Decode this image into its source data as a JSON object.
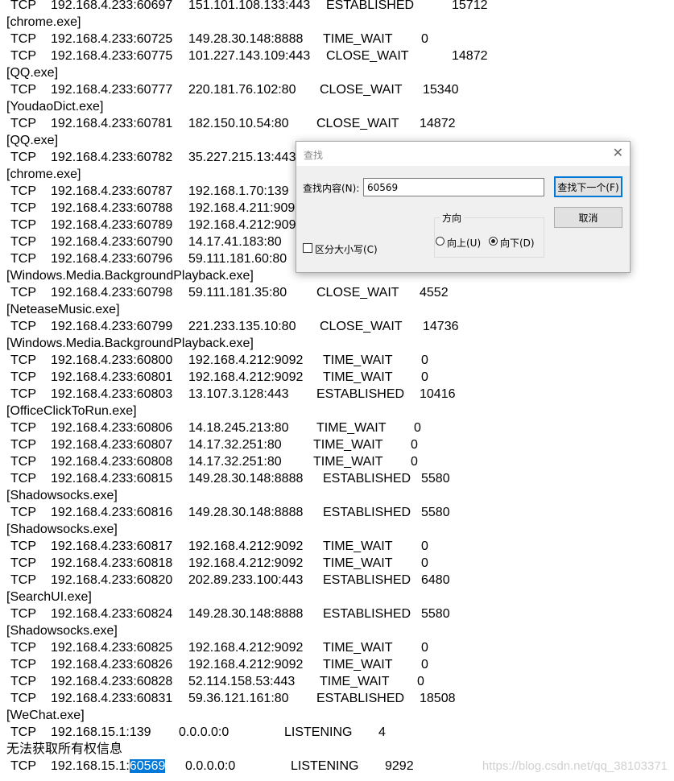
{
  "lines": [
    {
      "type": "conn",
      "proto": "TCP",
      "local": "192.168.4.233:60697",
      "foreign": "151.101.108.133:443",
      "state": "ESTABLISHED",
      "pid": "15712",
      "pos": "a"
    },
    {
      "type": "exe",
      "text": "[chrome.exe]"
    },
    {
      "type": "conn",
      "proto": "TCP",
      "local": "192.168.4.233:60725",
      "foreign": "149.28.30.148:8888",
      "state": "TIME_WAIT",
      "pid": "0",
      "pos": "b"
    },
    {
      "type": "conn",
      "proto": "TCP",
      "local": "192.168.4.233:60775",
      "foreign": "101.227.143.109:443",
      "state": "CLOSE_WAIT",
      "pid": "14872",
      "pos": "a"
    },
    {
      "type": "exe",
      "text": "[QQ.exe]"
    },
    {
      "type": "conn",
      "proto": "TCP",
      "local": "192.168.4.233:60777",
      "foreign": "220.181.76.102:80",
      "state": "CLOSE_WAIT",
      "pid": "15340",
      "pos": "c"
    },
    {
      "type": "exe",
      "text": "[YoudaoDict.exe]"
    },
    {
      "type": "conn",
      "proto": "TCP",
      "local": "192.168.4.233:60781",
      "foreign": "182.150.10.54:80",
      "state": "CLOSE_WAIT",
      "pid": "14872",
      "pos": "d"
    },
    {
      "type": "exe",
      "text": "[QQ.exe]"
    },
    {
      "type": "conn",
      "proto": "TCP",
      "local": "192.168.4.233:60782",
      "foreign": "35.227.215.13:443",
      "state": "",
      "pid": "",
      "pos": "a"
    },
    {
      "type": "exe",
      "text": "[chrome.exe]"
    },
    {
      "type": "conn",
      "proto": "TCP",
      "local": "192.168.4.233:60787",
      "foreign": "192.168.1.70:139",
      "state": "",
      "pid": "",
      "pos": "a"
    },
    {
      "type": "conn",
      "proto": "TCP",
      "local": "192.168.4.233:60788",
      "foreign": "192.168.4.211:909",
      "state": "",
      "pid": "",
      "pos": "a"
    },
    {
      "type": "conn",
      "proto": "TCP",
      "local": "192.168.4.233:60789",
      "foreign": "192.168.4.212:909",
      "state": "",
      "pid": "",
      "pos": "a"
    },
    {
      "type": "conn",
      "proto": "TCP",
      "local": "192.168.4.233:60790",
      "foreign": "14.17.41.183:80",
      "state": "",
      "pid": "",
      "pos": "a"
    },
    {
      "type": "conn",
      "proto": "TCP",
      "local": "192.168.4.233:60796",
      "foreign": "59.111.181.60:80",
      "state": "",
      "pid": "",
      "pos": "a"
    },
    {
      "type": "exe",
      "text": "[Windows.Media.BackgroundPlayback.exe]"
    },
    {
      "type": "conn",
      "proto": "TCP",
      "local": "192.168.4.233:60798",
      "foreign": "59.111.181.35:80",
      "state": "CLOSE_WAIT",
      "pid": "4552",
      "pos": "d"
    },
    {
      "type": "exe",
      "text": "[NeteaseMusic.exe]"
    },
    {
      "type": "conn",
      "proto": "TCP",
      "local": "192.168.4.233:60799",
      "foreign": "221.233.135.10:80",
      "state": "CLOSE_WAIT",
      "pid": "14736",
      "pos": "c"
    },
    {
      "type": "exe",
      "text": "[Windows.Media.BackgroundPlayback.exe]"
    },
    {
      "type": "conn",
      "proto": "TCP",
      "local": "192.168.4.233:60800",
      "foreign": "192.168.4.212:9092",
      "state": "TIME_WAIT",
      "pid": "0",
      "pos": "b"
    },
    {
      "type": "conn",
      "proto": "TCP",
      "local": "192.168.4.233:60801",
      "foreign": "192.168.4.212:9092",
      "state": "TIME_WAIT",
      "pid": "0",
      "pos": "b"
    },
    {
      "type": "conn",
      "proto": "TCP",
      "local": "192.168.4.233:60803",
      "foreign": "13.107.3.128:443",
      "state": "ESTABLISHED",
      "pid": "10416",
      "pos": "d"
    },
    {
      "type": "exe",
      "text": "[OfficeClickToRun.exe]"
    },
    {
      "type": "conn",
      "proto": "TCP",
      "local": "192.168.4.233:60806",
      "foreign": "14.18.245.213:80",
      "state": "TIME_WAIT",
      "pid": "0",
      "pos": "e"
    },
    {
      "type": "conn",
      "proto": "TCP",
      "local": "192.168.4.233:60807",
      "foreign": "14.17.32.251:80",
      "state": "TIME_WAIT",
      "pid": "0",
      "pos": "f"
    },
    {
      "type": "conn",
      "proto": "TCP",
      "local": "192.168.4.233:60808",
      "foreign": "14.17.32.251:80",
      "state": "TIME_WAIT",
      "pid": "0",
      "pos": "f"
    },
    {
      "type": "conn",
      "proto": "TCP",
      "local": "192.168.4.233:60815",
      "foreign": "149.28.30.148:8888",
      "state": "ESTABLISHED",
      "pid": "5580",
      "pos": "b"
    },
    {
      "type": "exe",
      "text": "[Shadowsocks.exe]"
    },
    {
      "type": "conn",
      "proto": "TCP",
      "local": "192.168.4.233:60816",
      "foreign": "149.28.30.148:8888",
      "state": "ESTABLISHED",
      "pid": "5580",
      "pos": "b"
    },
    {
      "type": "exe",
      "text": "[Shadowsocks.exe]"
    },
    {
      "type": "conn",
      "proto": "TCP",
      "local": "192.168.4.233:60817",
      "foreign": "192.168.4.212:9092",
      "state": "TIME_WAIT",
      "pid": "0",
      "pos": "b"
    },
    {
      "type": "conn",
      "proto": "TCP",
      "local": "192.168.4.233:60818",
      "foreign": "192.168.4.212:9092",
      "state": "TIME_WAIT",
      "pid": "0",
      "pos": "b"
    },
    {
      "type": "conn",
      "proto": "TCP",
      "local": "192.168.4.233:60820",
      "foreign": "202.89.233.100:443",
      "state": "ESTABLISHED",
      "pid": "6480",
      "pos": "b"
    },
    {
      "type": "exe",
      "text": "[SearchUI.exe]"
    },
    {
      "type": "conn",
      "proto": "TCP",
      "local": "192.168.4.233:60824",
      "foreign": "149.28.30.148:8888",
      "state": "ESTABLISHED",
      "pid": "5580",
      "pos": "b"
    },
    {
      "type": "exe",
      "text": "[Shadowsocks.exe]"
    },
    {
      "type": "conn",
      "proto": "TCP",
      "local": "192.168.4.233:60825",
      "foreign": "192.168.4.212:9092",
      "state": "TIME_WAIT",
      "pid": "0",
      "pos": "b"
    },
    {
      "type": "conn",
      "proto": "TCP",
      "local": "192.168.4.233:60826",
      "foreign": "192.168.4.212:9092",
      "state": "TIME_WAIT",
      "pid": "0",
      "pos": "b"
    },
    {
      "type": "conn",
      "proto": "TCP",
      "local": "192.168.4.233:60828",
      "foreign": "52.114.158.53:443",
      "state": "TIME_WAIT",
      "pid": "0",
      "pos": "g"
    },
    {
      "type": "conn",
      "proto": "TCP",
      "local": "192.168.4.233:60831",
      "foreign": "59.36.121.161:80",
      "state": "ESTABLISHED",
      "pid": "18508",
      "pos": "d"
    },
    {
      "type": "exe",
      "text": "[WeChat.exe]"
    },
    {
      "type": "conn",
      "proto": "TCP",
      "local": "192.168.15.1:139",
      "foreign": "0.0.0.0:0",
      "state": "LISTENING",
      "pid": "4",
      "pos": "h"
    },
    {
      "type": "exe",
      "text": "无法获取所有权信息"
    },
    {
      "type": "conn",
      "proto": "TCP",
      "local": "192.168.15.1:",
      "local_hl": "60569",
      "foreign": "0.0.0.0:0",
      "state": "LISTENING",
      "pid": "9292",
      "pos": "i"
    }
  ],
  "find_dialog": {
    "title": "查找",
    "close_glyph": "✕",
    "find_label": "查找内容(N):",
    "find_value": "60569",
    "find_next_label": "查找下一个(F)",
    "cancel_label": "取消",
    "direction_label": "方向",
    "up_label": "向上(U)",
    "down_label": "向下(D)",
    "direction_selected": "down",
    "match_case_label": "区分大小写(C)",
    "match_case_checked": false
  },
  "watermark": "https://blog.csdn.net/qq_38103371"
}
